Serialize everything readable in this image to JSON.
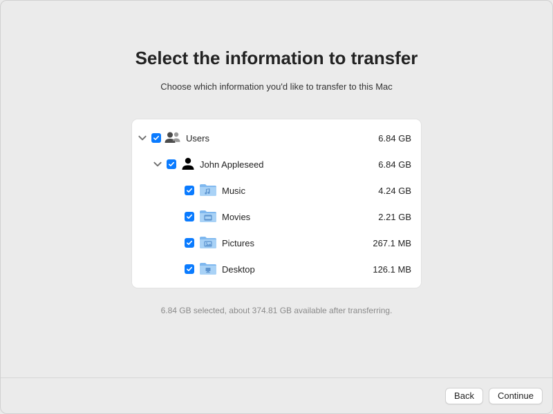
{
  "heading": "Select the information to transfer",
  "subheading": "Choose which information you'd like to transfer to this Mac",
  "tree": {
    "users": {
      "label": "Users",
      "size": "6.84 GB",
      "checked": true,
      "expanded": true,
      "children": [
        {
          "label": "John Appleseed",
          "size": "6.84 GB",
          "checked": true,
          "expanded": true,
          "folders": [
            {
              "label": "Music",
              "size": "4.24 GB",
              "checked": true,
              "icon": "music"
            },
            {
              "label": "Movies",
              "size": "2.21 GB",
              "checked": true,
              "icon": "movies"
            },
            {
              "label": "Pictures",
              "size": "267.1 MB",
              "checked": true,
              "icon": "pictures"
            },
            {
              "label": "Desktop",
              "size": "126.1 MB",
              "checked": true,
              "icon": "desktop"
            }
          ]
        }
      ]
    }
  },
  "status": "6.84 GB selected, about 374.81 GB available after transferring.",
  "buttons": {
    "back": "Back",
    "continue": "Continue"
  }
}
